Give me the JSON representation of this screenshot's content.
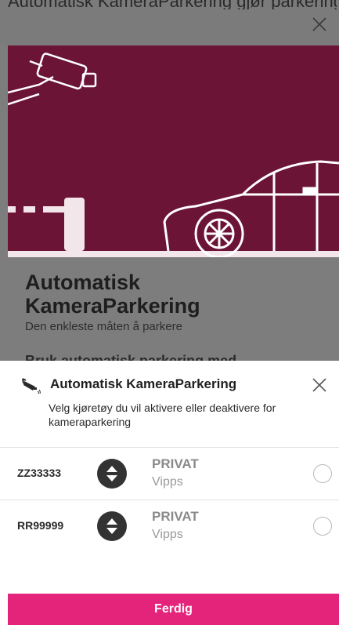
{
  "background": {
    "top_clipped_text": "Automatisk KameraParkering gjør parkering enklere og raskere",
    "title_line1": "Automatisk",
    "title_line2": "KameraParkering",
    "subtitle": "Den enkleste måten å parkere",
    "clipped_text": "Bruk automatisk parkering med",
    "hero_color": "#6b1436",
    "overlay_color": "#7d7d7d"
  },
  "sheet": {
    "title": "Automatisk KameraParkering",
    "description": "Velg kjøretøy du vil aktivere eller deaktivere for kameraparkering",
    "vehicles": [
      {
        "plate": "ZZ33333",
        "type": "PRIVAT",
        "provider": "Vipps",
        "selected": false
      },
      {
        "plate": "RR99999",
        "type": "PRIVAT",
        "provider": "Vipps",
        "selected": false
      }
    ],
    "done_label": "Ferdig"
  },
  "icons": {
    "close": "close-icon",
    "camera": "camera-icon",
    "sort": "sort-icon"
  },
  "colors": {
    "accent": "#e4237b",
    "hero": "#6b1436"
  }
}
